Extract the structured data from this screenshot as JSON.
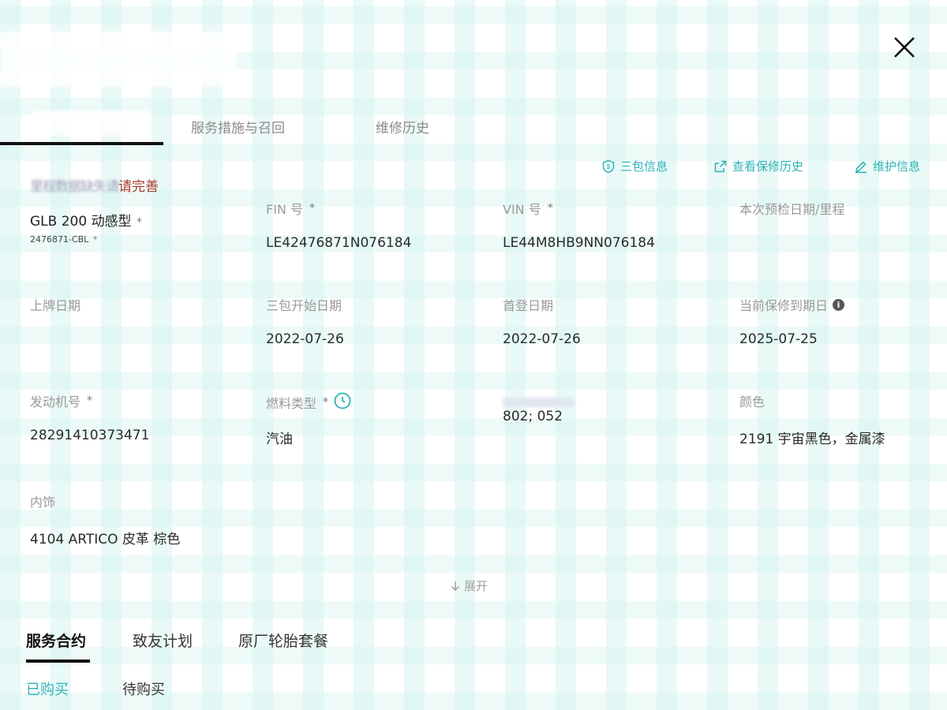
{
  "tabs_top": [
    "服务措施与召回",
    "维修历史"
  ],
  "actions": {
    "three_guarantee": "三包信息",
    "view_warranty_history": "查看保修历史",
    "maintain_info": "维护信息"
  },
  "warning": {
    "blurred_text": "里程数据缺失请",
    "text": "请完善"
  },
  "vehicle": {
    "model_name": "GLB 200 动感型",
    "model_code": "2476871-CBL",
    "fields": [
      {
        "label": "FIN 号",
        "value": "LE42476871N076184"
      },
      {
        "label": "VIN 号",
        "value": "LE44M8HB9NN076184"
      },
      {
        "label": "本次预检日期/里程",
        "value": ""
      },
      {
        "label": "上牌日期",
        "value": ""
      },
      {
        "label": "三包开始日期",
        "value": "2022-07-26"
      },
      {
        "label": "首登日期",
        "value": "2022-07-26"
      },
      {
        "label": "当前保修到期日",
        "value": "2025-07-25"
      },
      {
        "label": "发动机号",
        "value": "28291410373471"
      },
      {
        "label": "燃料类型",
        "value": "汽油"
      },
      {
        "label": "",
        "value": "802; 052"
      },
      {
        "label": "颜色",
        "value": "2191 宇宙黑色，金属漆"
      },
      {
        "label": "内饰",
        "value": "4104 ARTICO 皮革 棕色"
      }
    ]
  },
  "expand_label": "展开",
  "tabs_bottom": [
    "服务合约",
    "致友计划",
    "原厂轮胎套餐"
  ],
  "subtabs": [
    "已购买",
    "待购买"
  ],
  "colors": {
    "accent": "#2bb3b7",
    "warning": "#a23b2e",
    "label": "#9a9a9a",
    "text": "#2a2a2a",
    "background_pattern": "#d7f4f0"
  },
  "icons": {
    "close": "close-icon",
    "shield": "shield-icon",
    "external": "external-link-icon",
    "edit": "edit-icon",
    "info": "info-icon",
    "clock": "clock-icon",
    "arrow_down": "arrow-down-icon"
  }
}
